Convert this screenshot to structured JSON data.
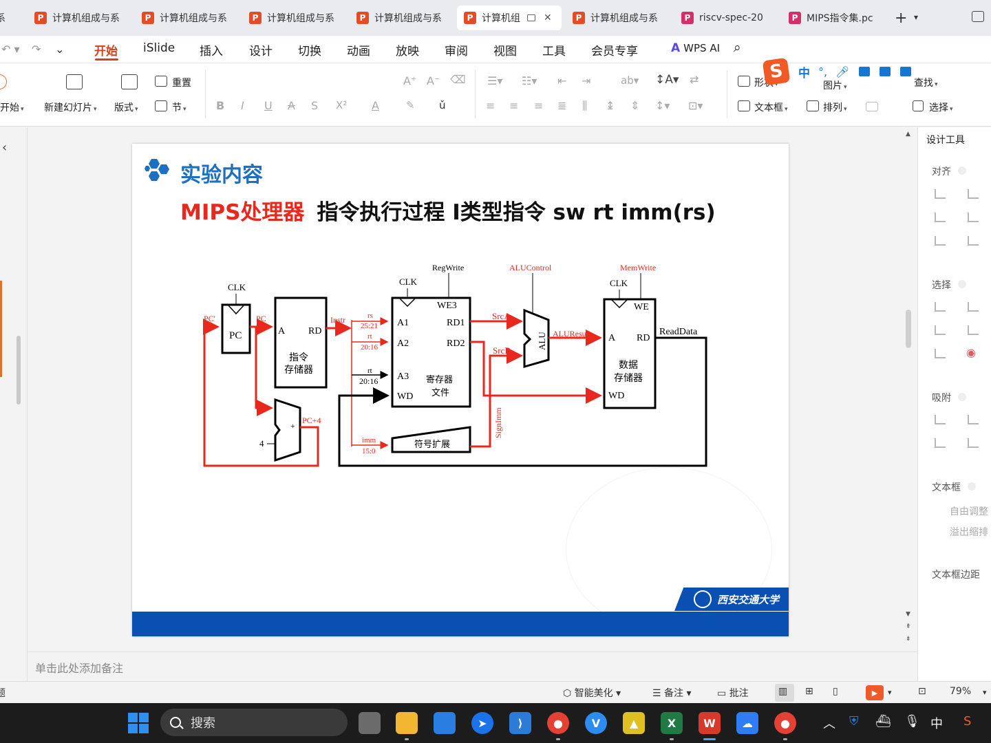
{
  "tabs": [
    {
      "label": "计算机组成与系",
      "kind": "ppt"
    },
    {
      "label": "计算机组成与系",
      "kind": "ppt"
    },
    {
      "label": "计算机组成与系",
      "kind": "ppt"
    },
    {
      "label": "计算机组成与系",
      "kind": "ppt"
    },
    {
      "label": "计算机组",
      "kind": "ppt",
      "active": true
    },
    {
      "label": "计算机组成与系",
      "kind": "ppt"
    },
    {
      "label": "riscv-spec-20",
      "kind": "pdf"
    },
    {
      "label": "MIPS指令集.pc",
      "kind": "pdf"
    }
  ],
  "tab_icon_letter": "P",
  "tab_add": "+",
  "menu": [
    "开始",
    "iSlide",
    "插入",
    "设计",
    "切换",
    "动画",
    "放映",
    "审阅",
    "视图",
    "工具",
    "会员专享"
  ],
  "wps_ai": "WPS AI",
  "ribbon": {
    "new_slide": "新建幻灯片",
    "layout": "版式",
    "reset": "重置",
    "section": "节",
    "start_partial": "开始",
    "format_buttons": [
      "B",
      "I",
      "U",
      "A",
      "S",
      "X²",
      "A"
    ],
    "shape": "形状",
    "picture": "图片",
    "find": "查找",
    "textbox": "文本框",
    "arrange": "排列",
    "select": "选择"
  },
  "ime": {
    "cn": "中",
    "logo": "S"
  },
  "slide": {
    "heading": "实验内容",
    "title_red": "MIPS处理器",
    "title_black": "指令执行过程 I类型指令 sw rt imm(rs)",
    "university": "西安交通大学"
  },
  "diagram": {
    "clk": "CLK",
    "pc_prime": "PC'",
    "pc": "PC",
    "pc_box": "PC",
    "instr": "Instr",
    "imem_a": "A",
    "imem_rd": "RD",
    "imem_label1": "指令",
    "imem_label2": "存储器",
    "four": "4",
    "plus": "+",
    "pc_plus4": "PC+4",
    "regwrite": "RegWrite",
    "rs": "rs",
    "rs_bits": "25:21",
    "rt1": "rt",
    "rt1_bits": "20:16",
    "rt2": "rt",
    "rt2_bits": "20:16",
    "imm": "imm",
    "imm_bits": "15:0",
    "a1": "A1",
    "a2": "A2",
    "a3": "A3",
    "wd": "WD",
    "we3": "WE3",
    "rd1": "RD1",
    "rd2": "RD2",
    "rf_label1": "寄存器",
    "rf_label2": "文件",
    "sign_ext": "符号扩展",
    "signimm": "SignImm",
    "aluctrl": "ALUControl",
    "srca": "SrcA",
    "srcb": "SrcB",
    "alu": "ALU",
    "aluresult": "ALUResult",
    "memwrite": "MemWrite",
    "dm_we": "WE",
    "dm_a": "A",
    "dm_rd": "RD",
    "dm_wd": "WD",
    "dm_label1": "数据",
    "dm_label2": "存储器",
    "readdata": "ReadData",
    "active_color": "#e8281c",
    "wire_color": "#000000"
  },
  "right_panel": {
    "title": "设计工具",
    "align": "对齐",
    "select": "选择",
    "snap": "吸附",
    "textbox": "文本框",
    "auto_fit": "自由调整",
    "overflow": "溢出缩排",
    "margin": "文本框边距"
  },
  "notes_placeholder": "单击此处添加备注",
  "status": {
    "beautify": "智能美化",
    "notes": "备注",
    "comment": "批注",
    "zoom": "79%",
    "left_fragment": "题"
  },
  "taskbar": {
    "search": "搜索",
    "ime": "中"
  },
  "colors": {
    "accent": "#d4421d",
    "heading_blue": "#1d6fbf",
    "footer_blue": "#0a4fb2",
    "title_red": "#e8281c"
  }
}
